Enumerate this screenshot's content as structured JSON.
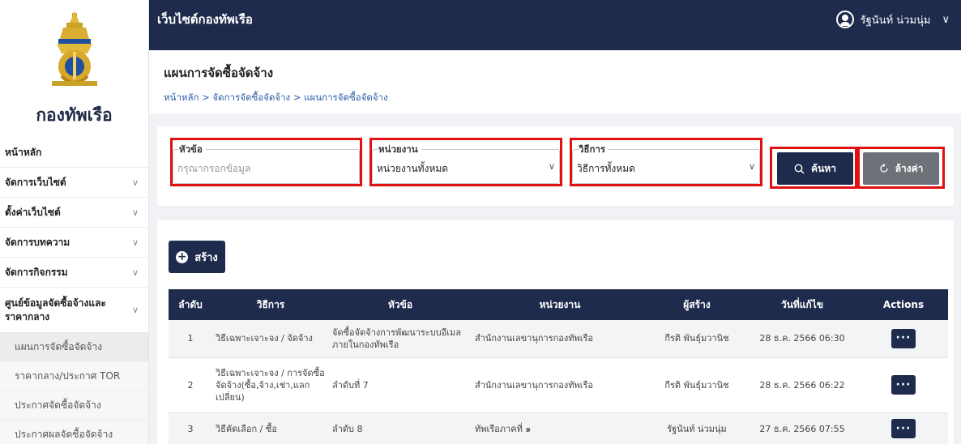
{
  "brand": {
    "logo_icon": "navy-emblem-icon",
    "title": "กองทัพเรือ"
  },
  "topbar": {
    "site_title": "เว็บไซต์กองทัพเรือ",
    "user_name": "รัฐนันท์ น่วมนุ่ม",
    "user_icon": "user-circle-icon",
    "chevron": "∨"
  },
  "sidebar": {
    "items": [
      {
        "label": "หน้าหลัก",
        "chevron": ""
      },
      {
        "label": "จัดการเว็บไซต์",
        "chevron": "∨"
      },
      {
        "label": "ตั้งค่าเว็บไซต์",
        "chevron": "∨"
      },
      {
        "label": "จัดการบทความ",
        "chevron": "∨"
      },
      {
        "label": "จัดการกิจกรรม",
        "chevron": "∨"
      },
      {
        "label": "ศูนย์ข้อมูลจัดซื้อจ้างและราคากลาง",
        "chevron": "∨"
      }
    ],
    "subitems": [
      {
        "label": "แผนการจัดซื้อจัดจ้าง"
      },
      {
        "label": "ราคากลาง/ประกาศ TOR"
      },
      {
        "label": "ประกาศจัดซื้อจัดจ้าง"
      },
      {
        "label": "ประกาศผลจัดซื้อจัดจ้าง"
      }
    ]
  },
  "page": {
    "title": "แผนการจัดซื้อจัดจ้าง",
    "breadcrumb": "หน้าหลัก > จัดการจัดซื้อจัดจ้าง > แผนการจัดซื้อจัดจ้าง"
  },
  "filters": {
    "topic_label": "หัวข้อ",
    "topic_placeholder": "กรุณากรอกข้อมูล",
    "unit_label": "หน่วยงาน",
    "unit_value": "หน่วยงานทั้งหมด",
    "method_label": "วิธีการ",
    "method_value": "วิธีการทั้งหมด",
    "search_label": "ค้นหา",
    "reset_label": "ล้างค่า"
  },
  "colors": {
    "navy": "#1e2b4d",
    "highlight": "#e01010",
    "reset_button": "#6d7278"
  },
  "create_label": "สร้าง",
  "table": {
    "headers": [
      "ลำดับ",
      "วิธีการ",
      "หัวข้อ",
      "หน่วยงาน",
      "ผู้สร้าง",
      "วันที่แก้ไข",
      "Actions"
    ],
    "rows": [
      {
        "no": "1",
        "method": "วิธีเฉพาะเจาะจง / จัดจ้าง",
        "topic": "จัดซื้อจัดจ้างการพัฒนาระบบอีเมลภายในกองทัพเรือ",
        "unit": "สำนักงานเลขานุการกองทัพเรือ",
        "creator": "กีรติ พันธุ์มวานิช",
        "date": "28 ธ.ค. 2566 06:30",
        "action": "···"
      },
      {
        "no": "2",
        "method": "วิธีเฉพาะเจาะจง / การจัดซื้อจัดจ้าง(ซื้อ,จ้าง,เช่า,แลกเปลี่ยน)",
        "topic": "ลำดับที่ 7",
        "unit": "สำนักงานเลขานุการกองทัพเรือ",
        "creator": "กีรติ พันธุ์มวานิช",
        "date": "28 ธ.ค. 2566 06:22",
        "action": "···"
      },
      {
        "no": "3",
        "method": "วิธีคัดเลือก / ซื้อ",
        "topic": "ลำดับ 8",
        "unit": "ทัพเรือภาคที่ ๑",
        "creator": "รัฐนันท์ น่วมนุ่ม",
        "date": "27 ธ.ค. 2566 07:55",
        "action": "···"
      }
    ]
  }
}
